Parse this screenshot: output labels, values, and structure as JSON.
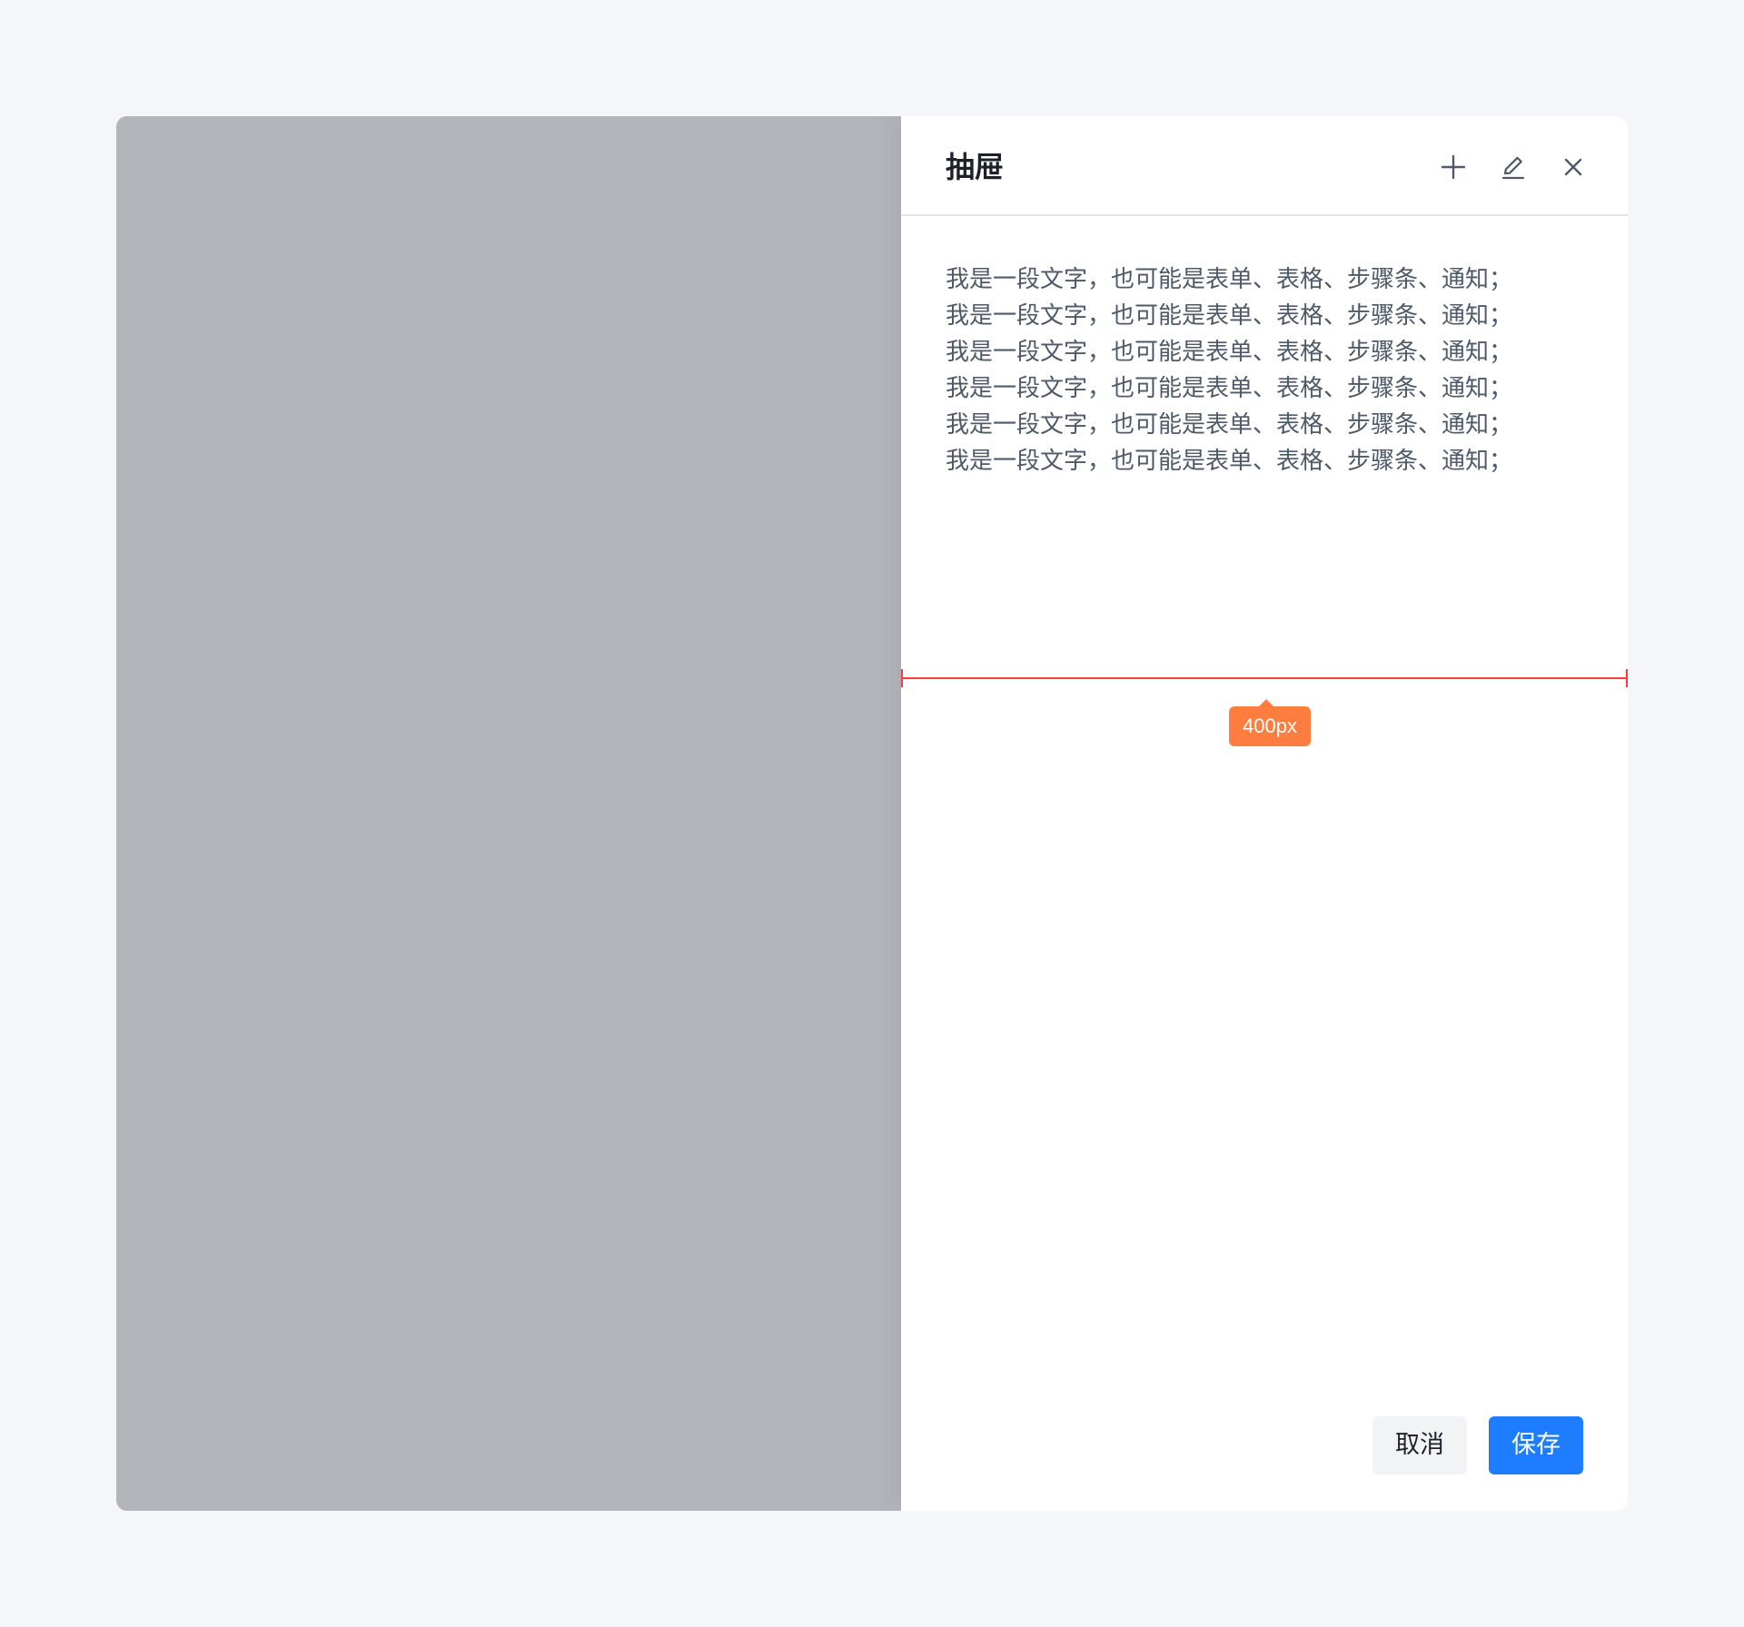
{
  "drawer": {
    "title": "抽屉",
    "actions": {
      "add_icon": "plus-icon",
      "edit_icon": "edit-icon",
      "close_icon": "close-icon"
    },
    "body_lines": [
      "我是一段文字，也可能是表单、表格、步骤条、通知；",
      "我是一段文字，也可能是表单、表格、步骤条、通知；",
      "我是一段文字，也可能是表单、表格、步骤条、通知；",
      "我是一段文字，也可能是表单、表格、步骤条、通知；",
      "我是一段文字，也可能是表单、表格、步骤条、通知；",
      "我是一段文字，也可能是表单、表格、步骤条、通知；"
    ],
    "width_annotation": "400px",
    "footer": {
      "cancel_label": "取消",
      "save_label": "保存"
    }
  },
  "colors": {
    "background": "#f5f6f9",
    "mask": "#b2b5ba",
    "primary": "#1e7cff",
    "annotation_line": "#f53f3f",
    "annotation_badge": "#ff7d3f"
  }
}
